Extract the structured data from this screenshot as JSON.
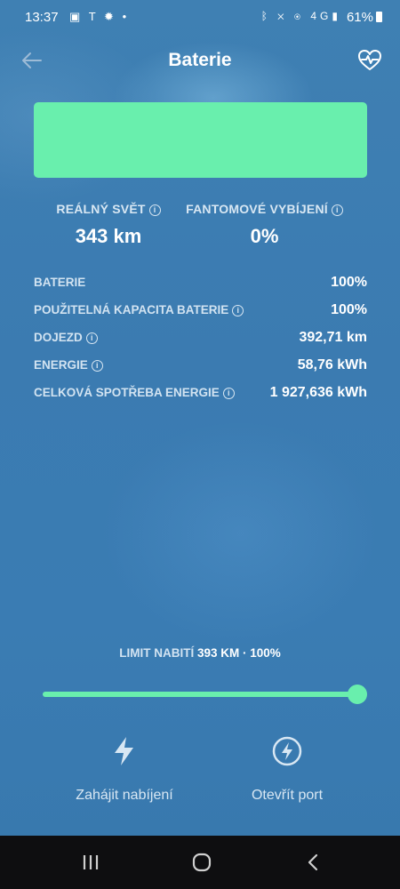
{
  "status_bar": {
    "time": "13:37",
    "left_icons": [
      "image-icon",
      "tesla-icon",
      "settings-icon",
      "dot-icon"
    ],
    "right_icons": [
      "bluetooth-icon",
      "mute-icon",
      "hotspot-icon",
      "4g-signal-icon"
    ],
    "battery_percent": "61%"
  },
  "header": {
    "title": "Baterie"
  },
  "battery_fill_fraction": 1.0,
  "accent_color": "#69efad",
  "stats": [
    {
      "label": "REÁLNÝ SVĚT",
      "value": "343 km"
    },
    {
      "label": "FANTOMOVÉ VYBÍJENÍ",
      "value": "0%"
    }
  ],
  "info_rows": [
    {
      "label": "BATERIE",
      "value": "100%",
      "info": false
    },
    {
      "label": "POUŽITELNÁ KAPACITA BATERIE",
      "value": "100%",
      "info": true
    },
    {
      "label": "DOJEZD",
      "value": "392,71 km",
      "info": true
    },
    {
      "label": "ENERGIE",
      "value": "58,76 kWh",
      "info": true
    },
    {
      "label": "CELKOVÁ SPOTŘEBA ENERGIE",
      "value": "1 927,636 kWh",
      "info": true
    }
  ],
  "charge_limit": {
    "label": "LIMIT NABITÍ",
    "value": "393 KM · 100%",
    "fraction": 1.0
  },
  "actions": {
    "start_charging": "Zahájit nabíjení",
    "open_port": "Otevřít port"
  }
}
